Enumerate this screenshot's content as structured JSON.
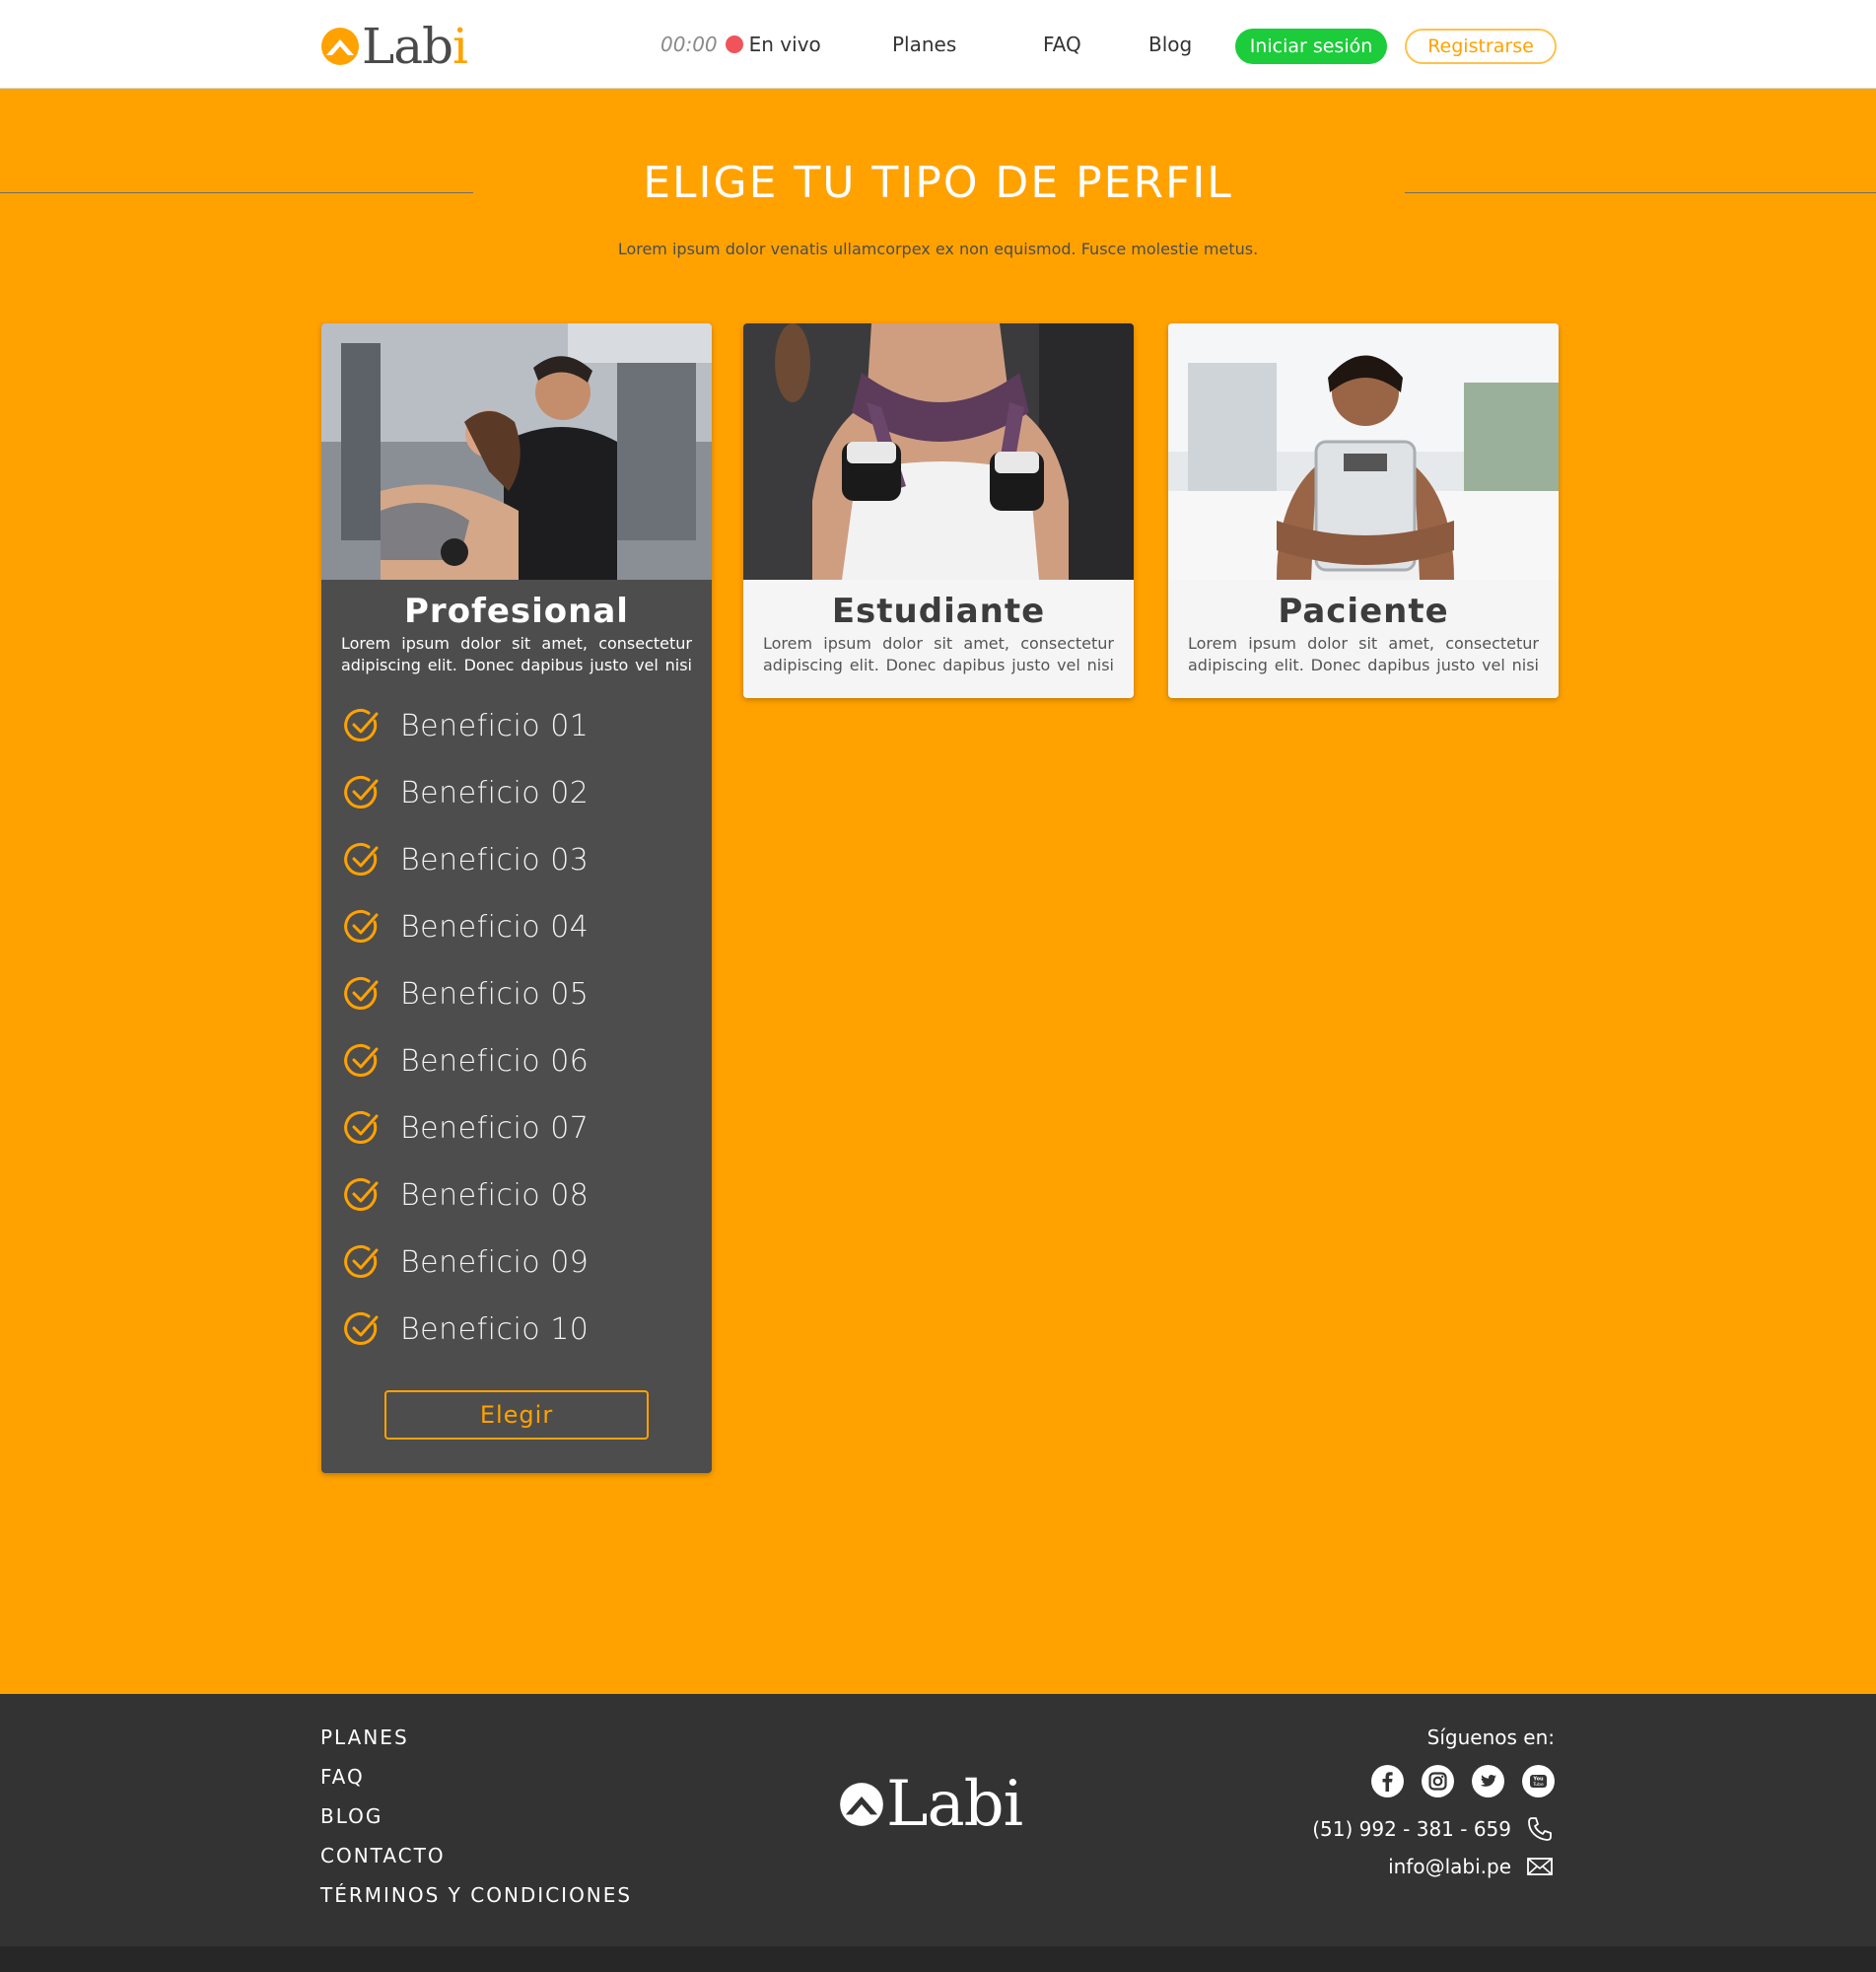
{
  "header": {
    "logo_text_main": "Lab",
    "logo_text_accent": "i",
    "live_time": "00:00",
    "live_label": "En vivo",
    "nav": [
      "Planes",
      "FAQ",
      "Blog"
    ],
    "login_label": "Iniciar sesión",
    "register_label": "Registrarse"
  },
  "hero": {
    "title": "ELIGE TU TIPO DE PERFIL",
    "subtitle": "Lorem ipsum dolor venatis ullamcorpex ex non equismod. Fusce molestie metus."
  },
  "cards": [
    {
      "title": "Profesional",
      "description": "Lorem ipsum dolor sit amet, consectetur adipiscing elit. Donec dapibus justo vel nisi",
      "benefits": [
        "Beneficio 01",
        "Beneficio 02",
        "Beneficio 03",
        "Beneficio 04",
        "Beneficio 05",
        "Beneficio 06",
        "Beneficio 07",
        "Beneficio 08",
        "Beneficio 09",
        "Beneficio 10"
      ],
      "button_label": "Elegir",
      "expanded": true
    },
    {
      "title": "Estudiante",
      "description": "Lorem ipsum dolor sit amet, consectetur adipiscing elit. Donec dapibus justo vel nisi",
      "expanded": false
    },
    {
      "title": "Paciente",
      "description": "Lorem ipsum dolor sit amet, consectetur adipiscing elit. Donec dapibus justo vel nisi",
      "expanded": false
    }
  ],
  "footer": {
    "links": [
      "PLANES",
      "FAQ",
      "BLOG",
      "CONTACTO",
      "TÉRMINOS Y CONDICIONES"
    ],
    "follow_label": "Síguenos en:",
    "socials": [
      "facebook-icon",
      "instagram-icon",
      "twitter-icon",
      "youtube-icon"
    ],
    "youtube_text": "You Tube",
    "phone": "(51) 992 - 381 - 659",
    "email": "info@labi.pe"
  },
  "colors": {
    "accent": "#ffa200",
    "login_green": "#1ccc3a",
    "live_red": "#f0545a",
    "card_dark": "#4d4d4d",
    "footer_bg": "#333333"
  }
}
